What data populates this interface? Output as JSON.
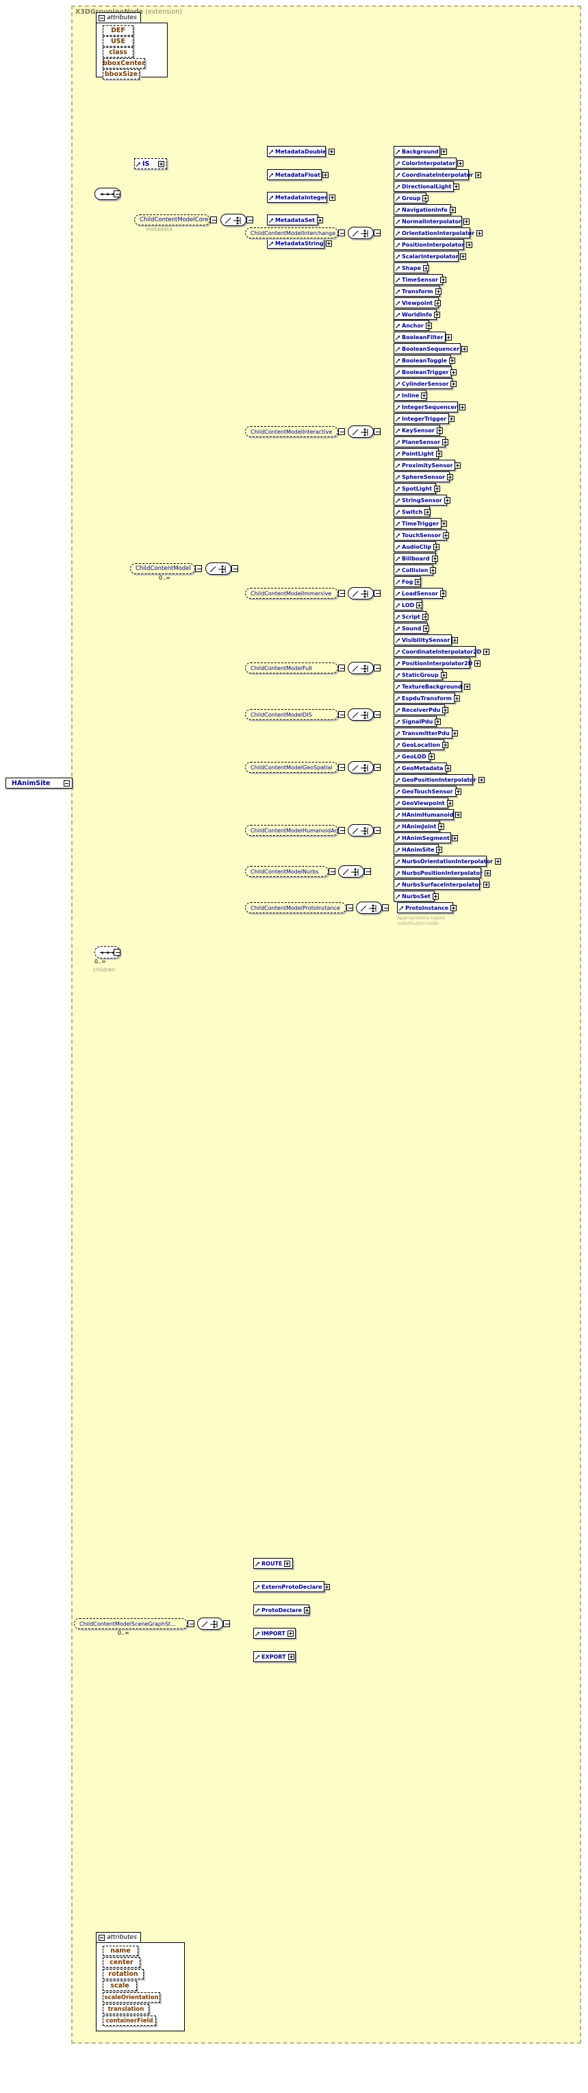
{
  "diagram": {
    "root": "HAnimSite",
    "extension_title": "X3DGroupingNode",
    "extension_suffix": "(extension)",
    "attributes_label": "attributes",
    "sub_metadata": "metadata",
    "sub_children": "children",
    "occurrence_unbounded": "0..∞",
    "proto_note_line1": "Appropriately-typed",
    "proto_note_line2": "substitution node"
  },
  "top_attributes": [
    {
      "label": "DEF"
    },
    {
      "label": "USE"
    },
    {
      "label": "class"
    },
    {
      "label": "bboxCenter"
    },
    {
      "label": "bboxSize"
    }
  ],
  "bottom_attributes": [
    {
      "label": "name"
    },
    {
      "label": "center"
    },
    {
      "label": "rotation"
    },
    {
      "label": "scale"
    },
    {
      "label": "scaleOrientation"
    },
    {
      "label": "translation"
    },
    {
      "label": "containerField"
    }
  ],
  "is_node": {
    "label": "IS"
  },
  "groups": {
    "core": "ChildContentModelCore",
    "model": "ChildContentModel",
    "interchange": "ChildContentModelInterchange",
    "interactive": "ChildContentModelInteractive",
    "immersive": "ChildContentModelImmersive",
    "full": "ChildContentModelFull",
    "dis": "ChildContentModelDIS",
    "geospatial": "ChildContentModelGeoSpatial",
    "humanoid": "ChildContentModelHumanoidAn...",
    "nurbs": "ChildContentModelNurbs",
    "protoinstance": "ChildContentModelProtoInstance",
    "scenegraph": "ChildContentModelSceneGraphSt..."
  },
  "core_children": [
    "MetadataDouble",
    "MetadataFloat",
    "MetadataInteger",
    "MetadataSet",
    "MetadataString"
  ],
  "interchange_children": [
    "Background",
    "ColorInterpolator",
    "CoordinateInterpolator",
    "DirectionalLight",
    "Group",
    "NavigationInfo",
    "NormalInterpolator",
    "OrientationInterpolator",
    "PositionInterpolator",
    "ScalarInterpolator",
    "Shape",
    "TimeSensor",
    "Transform",
    "Viewpoint",
    "WorldInfo"
  ],
  "interactive_children": [
    "Anchor",
    "BooleanFilter",
    "BooleanSequencer",
    "BooleanToggle",
    "BooleanTrigger",
    "CylinderSensor",
    "Inline",
    "IntegerSequencer",
    "IntegerTrigger",
    "KeySensor",
    "PlaneSensor",
    "PointLight",
    "ProximitySensor",
    "SphereSensor",
    "SpotLight",
    "StringSensor",
    "Switch",
    "TimeTrigger",
    "TouchSensor"
  ],
  "immersive_children": [
    "AudioClip",
    "Billboard",
    "Collision",
    "Fog",
    "LoadSensor",
    "LOD",
    "Script",
    "Sound",
    "VisibilitySensor"
  ],
  "full_children": [
    "CoordinateInterpolator2D",
    "PositionInterpolator2D",
    "StaticGroup",
    "TextureBackground"
  ],
  "dis_children": [
    "EspduTransform",
    "ReceiverPdu",
    "SignalPdu",
    "TransmitterPdu"
  ],
  "geospatial_children": [
    "GeoLocation",
    "GeoLOD",
    "GeoMetadata",
    "GeoPositionInterpolator",
    "GeoTouchSensor",
    "GeoViewpoint"
  ],
  "humanoid_children": [
    "HAnimHumanoid",
    "HAnimJoint",
    "HAnimSegment",
    "HAnimSite"
  ],
  "nurbs_children": [
    "NurbsOrientationInterpolator",
    "NurbsPositionInterpolator",
    "NurbsSurfaceInterpolator",
    "NurbsSet"
  ],
  "protoinstance_children": [
    "ProtoInstance"
  ],
  "scenegraph_children": [
    "ROUTE",
    "ExternProtoDeclare",
    "ProtoDeclare",
    "IMPORT",
    "EXPORT"
  ]
}
